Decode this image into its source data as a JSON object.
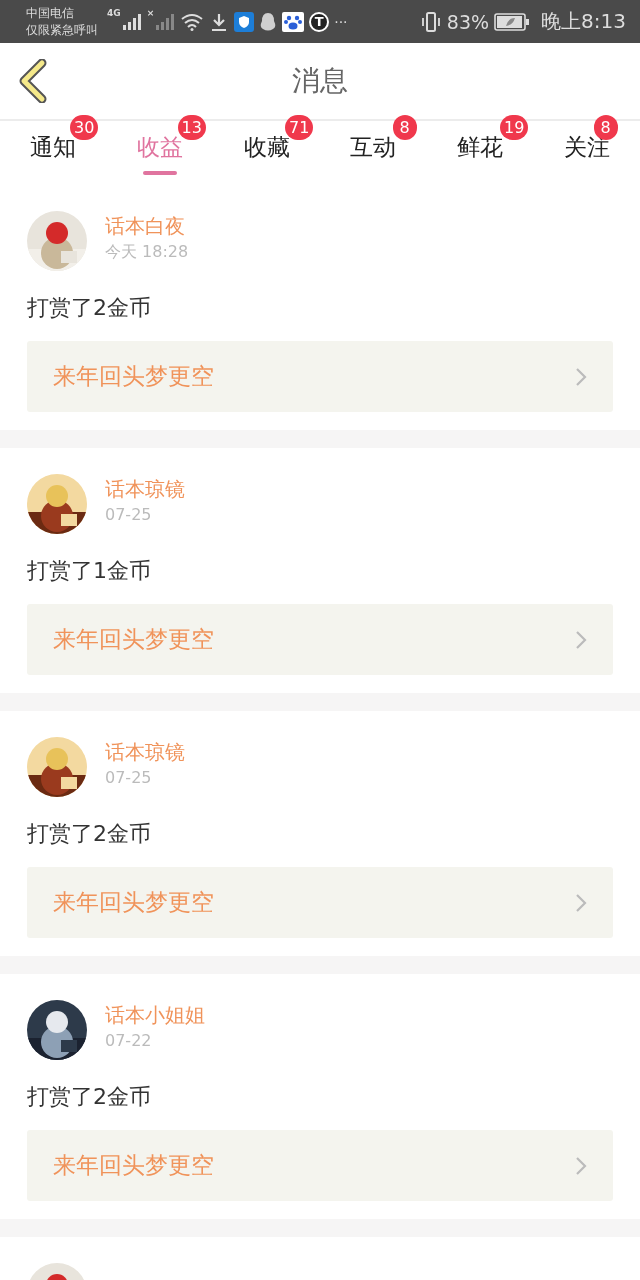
{
  "status_bar": {
    "carrier": "中国电信",
    "carrier_note": "仅限紧急呼叫",
    "network": "4G",
    "no_sim": "×",
    "app_letter": "T",
    "more": "···",
    "battery": "83%",
    "time": "晚上8:13"
  },
  "header": {
    "title": "消息"
  },
  "tabs": [
    {
      "label": "通知",
      "badge": "30",
      "selected": false
    },
    {
      "label": "收益",
      "badge": "13",
      "selected": true
    },
    {
      "label": "收藏",
      "badge": "71",
      "selected": false
    },
    {
      "label": "互动",
      "badge": "8",
      "selected": false
    },
    {
      "label": "鲜花",
      "badge": "19",
      "selected": false
    },
    {
      "label": "关注",
      "badge": "8",
      "selected": false
    }
  ],
  "messages": [
    {
      "user": "话本白夜",
      "time": "今天 18:28",
      "text": "打赏了2金币",
      "work": "来年回头梦更空"
    },
    {
      "user": "话本琼镜",
      "time": "07-25",
      "text": "打赏了1金币",
      "work": "来年回头梦更空"
    },
    {
      "user": "话本琼镜",
      "time": "07-25",
      "text": "打赏了2金币",
      "work": "来年回头梦更空"
    },
    {
      "user": "话本小姐姐",
      "time": "07-22",
      "text": "打赏了2金币",
      "work": "来年回头梦更空"
    },
    {
      "kind": "partial"
    }
  ]
}
